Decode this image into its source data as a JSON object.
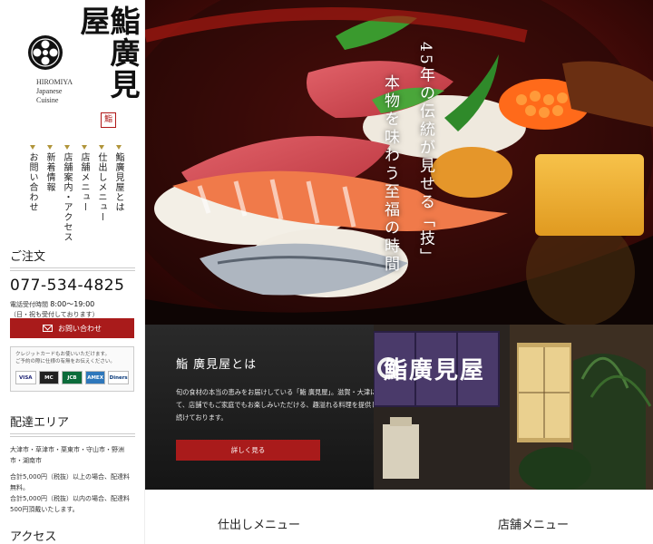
{
  "brand": {
    "name": "鮨廣見屋",
    "en_lines": [
      "HIROMIYA",
      "Japanese",
      "Cuisine"
    ],
    "seal": "鮨"
  },
  "nav": {
    "items": [
      "鮨廣見屋とは",
      "仕出しメニュー",
      "店舗メニュー",
      "店舗案内・アクセス",
      "新着情報",
      "お問い合わせ"
    ]
  },
  "order": {
    "heading": "ご注文",
    "phone": "077-534-4825",
    "hours_label": "電話受付時間",
    "hours_value": "8:00〜19:00",
    "hours_note": "（日・祝も受付しております）",
    "contact_button": "お問い合わせ"
  },
  "cards": {
    "note_line1": "クレジットカードもお使いいただけます。",
    "note_line2": "ご予約の際に仕様の有無をお伝えください。",
    "brands": [
      "VISA",
      "MC",
      "JCB",
      "AMEX",
      "Diners"
    ]
  },
  "delivery": {
    "heading": "配達エリア",
    "areas": "大津市・草津市・栗東市・守山市・野洲市・湖南市",
    "note1": "合計5,000円（税抜）以上の場合、配達料無料。",
    "note2": "合計5,000円（税抜）以内の場合、配達料500円頂戴いたします。"
  },
  "access": {
    "heading": "アクセス"
  },
  "hero": {
    "line1": "45年の伝統が見せる「技」",
    "line2": "本物を味わう至福の時間"
  },
  "about": {
    "title": "鮨 廣見屋とは",
    "text": "旬の食材の本当の恵みをお届けしている「鮨 廣見屋」。滋賀・大津にて、店舗でもご家庭でもお楽しみいただける、趣溢れる料理を提供し続けております。",
    "button": "詳しく見る",
    "sign_text": "鮨廣見屋"
  },
  "tabs": {
    "catering": "仕出しメニュー",
    "store": "店舗メニュー"
  },
  "colors": {
    "accent": "#a91b1b",
    "gold": "#b1953a"
  }
}
